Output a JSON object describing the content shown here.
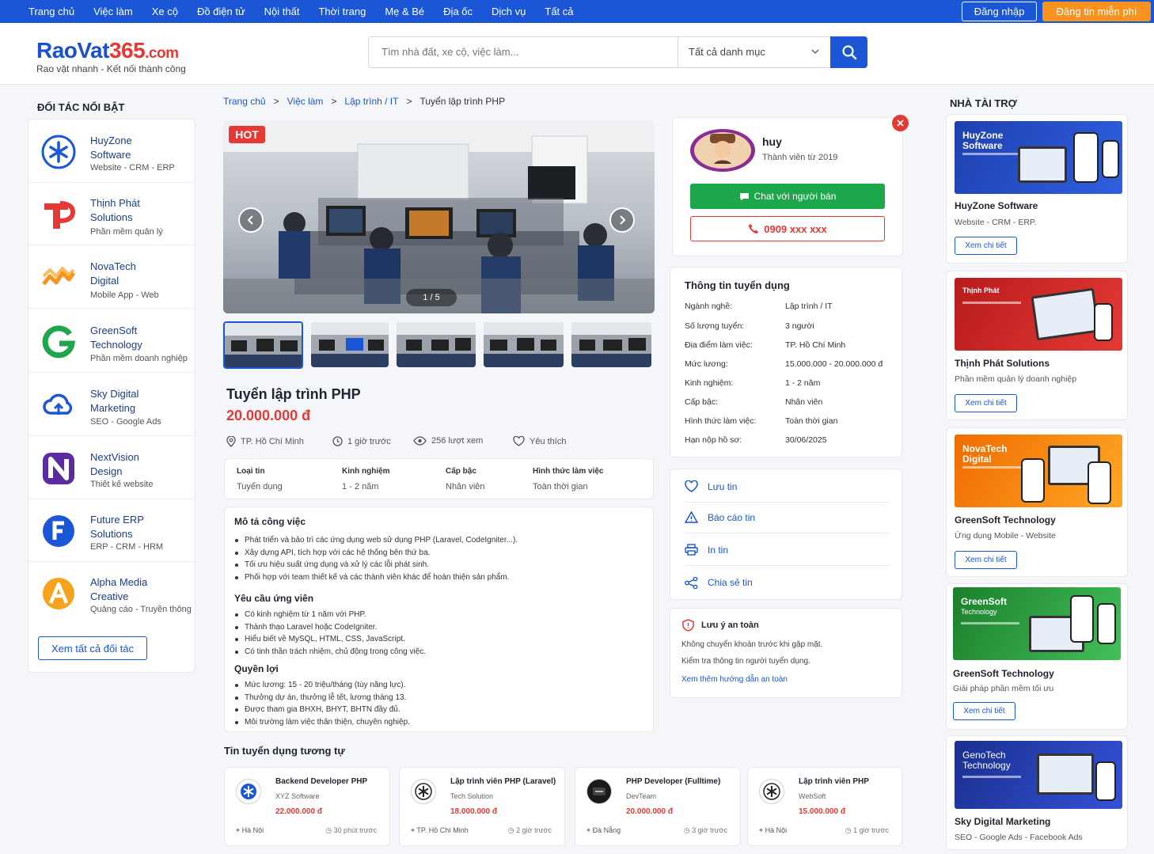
{
  "topnav": {
    "items": [
      "Trang chủ",
      "Việc làm",
      "Xe cộ",
      "Đồ điện tử",
      "Nội thất",
      "Thời trang",
      "Mẹ & Bé",
      "Địa ốc",
      "Dịch vụ",
      "Tất cả"
    ],
    "login": "Đăng nhập",
    "post": "Đăng tin miễn phí"
  },
  "header": {
    "logo_main": "RaoVat",
    "logo_num": "365",
    "logo_tld": ".com",
    "slogan": "Rao vặt nhanh - Kết nối thành công",
    "search_placeholder": "Tìm nhà đất, xe cộ, việc làm...",
    "category": "Tất cả danh mục"
  },
  "partners": {
    "title": "ĐỐI TÁC NỔI BẬT",
    "items": [
      {
        "name1": "HuyZone",
        "name2": "Software",
        "desc": "Website - CRM - ERP",
        "color": "#1a56d6"
      },
      {
        "name1": "Thịnh Phát",
        "name2": "Solutions",
        "desc": "Phần mềm quản lý",
        "color": "#e53935"
      },
      {
        "name1": "NovaTech",
        "name2": "Digital",
        "desc": "Mobile App - Web",
        "color": "#f7931e"
      },
      {
        "name1": "GreenSoft",
        "name2": "Technology",
        "desc": "Phần mềm doanh nghiệp",
        "color": "#1ea64b"
      },
      {
        "name1": "Sky Digital",
        "name2": "Marketing",
        "desc": "SEO - Google Ads",
        "color": "#1a56d6"
      },
      {
        "name1": "NextVision",
        "name2": "Design",
        "desc": "Thiết kế website",
        "color": "#5b2ca0"
      },
      {
        "name1": "Future ERP",
        "name2": "Solutions",
        "desc": "ERP - CRM - HRM",
        "color": "#1a56d6"
      },
      {
        "name1": "Alpha Media",
        "name2": "Creative",
        "desc": "Quảng cáo - Truyền thông",
        "color": "#f7a21e"
      }
    ],
    "view_all": "Xem tất cả đối tác"
  },
  "breadcrumb": [
    "Trang chủ",
    "Việc làm",
    "Lập trình / IT",
    "Tuyển lập trình PHP"
  ],
  "listing": {
    "hot": "HOT",
    "counter": "1 / 5",
    "title": "Tuyển lập trình PHP",
    "price": "20.000.000 đ",
    "location": "TP. Hồ Chí Minh",
    "time": "1 giờ trước",
    "views": "256 lượt xem",
    "like": "Yêu thích",
    "facts": [
      {
        "k": "Loại tin",
        "v": "Tuyển dụng"
      },
      {
        "k": "Kinh nghiệm",
        "v": "1 - 2 năm"
      },
      {
        "k": "Cấp bậc",
        "v": "Nhân viên"
      },
      {
        "k": "Hình thức làm việc",
        "v": "Toàn thời gian"
      }
    ],
    "desc_title": "Mô tả công việc",
    "desc": [
      "Phát triển và bảo trì các ứng dụng web sử dụng PHP (Laravel, CodeIgniter...).",
      "Xây dựng API, tích hợp với các hệ thống bên thứ ba.",
      "Tối ưu hiệu suất ứng dụng và xử lý các lỗi phát sinh.",
      "Phối hợp với team thiết kế và các thành viên khác để hoàn thiện sản phẩm."
    ],
    "req_title": "Yêu cầu ứng viên",
    "req": [
      "Có kinh nghiệm từ 1 năm với PHP.",
      "Thành thạo Laravel hoặc CodeIgniter.",
      "Hiểu biết về MySQL, HTML, CSS, JavaScript.",
      "Có tinh thần trách nhiệm, chủ động trong công việc."
    ],
    "ben_title": "Quyền lợi",
    "ben": [
      "Mức lương: 15 - 20 triệu/tháng (tùy năng lực).",
      "Thưởng dự án, thưởng lễ tết, lương tháng 13.",
      "Được tham gia BHXH, BHYT, BHTN đầy đủ.",
      "Môi trường làm việc thân thiện, chuyên nghiệp."
    ]
  },
  "similar": {
    "title": "Tin tuyển dụng tương tự",
    "items": [
      {
        "title": "Backend Developer PHP",
        "company": "XYZ Software",
        "price": "22.000.000 đ",
        "loc": "Hà Nội",
        "time": "30 phút trước"
      },
      {
        "title": "Lập trình viên PHP (Laravel)",
        "company": "Tech Solution",
        "price": "18.000.000 đ",
        "loc": "TP. Hồ Chí Minh",
        "time": "2 giờ trước"
      },
      {
        "title": "PHP Developer (Fulltime)",
        "company": "DevTeam",
        "price": "20.000.000 đ",
        "loc": "Đà Nẵng",
        "time": "3 giờ trước"
      },
      {
        "title": "Lập trình viên PHP",
        "company": "WebSoft",
        "price": "15.000.000 đ",
        "loc": "Hà Nội",
        "time": "1 giờ trước"
      }
    ]
  },
  "seller": {
    "name": "huy",
    "since": "Thành viên từ 2019",
    "chat": "Chat với người bán",
    "phone": "0909 xxx xxx"
  },
  "info": {
    "title": "Thông tin tuyển dụng",
    "rows": [
      {
        "k": "Ngành nghề:",
        "v": "Lập trình / IT"
      },
      {
        "k": "Số lượng tuyển:",
        "v": "3 người"
      },
      {
        "k": "Địa điểm làm việc:",
        "v": "TP. Hồ Chí Minh"
      },
      {
        "k": "Mức lương:",
        "v": "15.000.000 - 20.000.000 đ"
      },
      {
        "k": "Kinh nghiệm:",
        "v": "1 - 2 năm"
      },
      {
        "k": "Cấp bậc:",
        "v": "Nhân viên"
      },
      {
        "k": "Hình thức làm việc:",
        "v": "Toàn thời gian"
      },
      {
        "k": "Hạn nộp hồ sơ:",
        "v": "30/06/2025"
      }
    ]
  },
  "actions": [
    "Lưu tin",
    "Báo cáo tin",
    "In tin",
    "Chia sẻ tin"
  ],
  "safety": {
    "title": "Lưu ý an toàn",
    "line1": "Không chuyển khoản trước khi gặp mặt.",
    "line2": "Kiểm tra thông tin người tuyển dụng.",
    "link": "Xem thêm hướng dẫn an toàn"
  },
  "sponsors": {
    "title": "NHÀ TÀI TRỢ",
    "items": [
      {
        "img1": "HuyZone",
        "img2": "Software",
        "name": "HuyZone Software",
        "desc": "Website - CRM - ERP.",
        "btn": "Xem chi tiết",
        "bg": "#1e40af"
      },
      {
        "img1": "Thịnh Phát",
        "img2": "",
        "name": "Thịnh Phát Solutions",
        "desc": "Phần mềm quản lý doanh nghiệp",
        "btn": "Xem chi tiết",
        "bg": "#c62828"
      },
      {
        "img1": "NovaTech",
        "img2": "Digital",
        "name": "GreenSoft Technology",
        "desc": "Ứng dụng Mobile - Website",
        "btn": "Xem chi tiết",
        "bg": "#f57c00"
      },
      {
        "img1": "GreenSoft",
        "img2": "Technology",
        "name": "GreenSoft Technology",
        "desc": "Giải pháp phần mềm tối ưu",
        "btn": "Xem chi tiết",
        "bg": "#2e9d3c"
      },
      {
        "img1": "GenoTech",
        "img2": "Technology",
        "name": "Sky Digital Marketing",
        "desc": "SEO - Google Ads - Facebook Ads",
        "btn": "",
        "bg": "#1e3aa8"
      }
    ]
  }
}
